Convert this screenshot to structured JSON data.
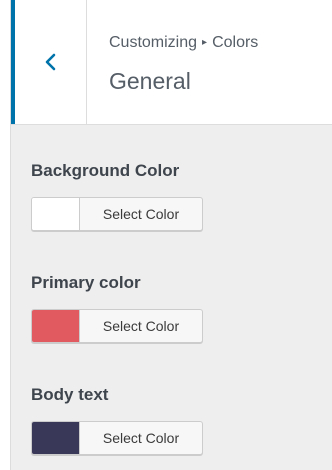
{
  "header": {
    "back_icon": "chevron-left-icon",
    "breadcrumb": {
      "root": "Customizing",
      "separator": "▸",
      "current": "Colors"
    },
    "section_title": "General"
  },
  "controls": [
    {
      "label": "Background Color",
      "button_label": "Select Color",
      "color": "#ffffff"
    },
    {
      "label": "Primary color",
      "button_label": "Select Color",
      "color": "#e05a60"
    },
    {
      "label": "Body text",
      "button_label": "Select Color",
      "color": "#3a3858"
    }
  ],
  "colors": {
    "accent": "#0073aa",
    "panel_background": "#eeeeee"
  }
}
